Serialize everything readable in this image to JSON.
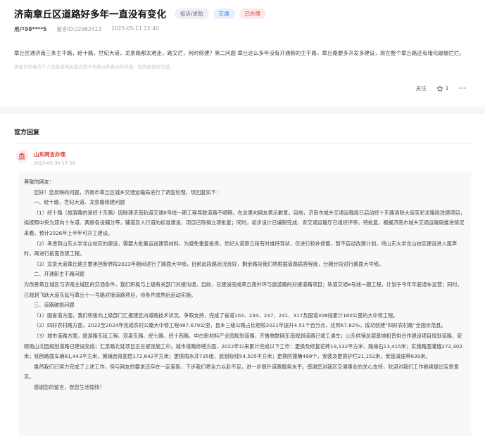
{
  "header": {
    "title": "济南章丘区道路好多年一直没有变化",
    "tags": [
      "投诉/求助",
      "交通",
      "已办理"
    ]
  },
  "meta": {
    "user": "用户98****5",
    "id_text": "留言ID:22962413",
    "time": "2025-05-11 22:40"
  },
  "description": "章丘区通济南三条主干路，经十路，世纪大道，龙泉路都太难走，路又烂，何时修建？第二问题 章丘这么多年没有开通新的主干路，章丘路要多开发多建设，现在整个章丘路还有堵化破破烂烂。",
  "notice": "该留言作者为个人信息或网友留言而不代表公开表示的内容，仅供阅读仅可见。",
  "actions": {
    "follow": "关注",
    "like_count": "1",
    "more": "···"
  },
  "official": {
    "section_title": "官方回复",
    "org_name": "山东网言办理",
    "org_time": "2025-05-30 17:58"
  },
  "reply_lines": [
    "尊敬的网友：",
    "您好！您反映的问题，济南市章丘区城乡交通运输局进行了调查处理，现回复如下：",
    "一、经十路、世纪大道、龙泉路修建问题",
    "（1）经十路（旅游路的是经十东路）因除建济南轨道交通8号线一期工程导致道路不顺畅，在这里向网友表示歉意。目前，济南市城乡交通运输局已启动经十东路清除大街至彩龙路段改建项目，拟按照中央为双向十车道、两侧各设辅分带，辅道及人行道的标准建设，项目已取得立项批复；同时，初步设计已编制完成，青交通运输厅已组织评审，待批复，根据济南市城乡交通运输局推进情况来看，预计2026年上半年可开工建设。",
    "（2）考虑到山东大学龙山校区的建设，需要大批量运送建筑材料，为避免重复投资，世纪大道章丘段有时维持现状，仅进行抢补修整，暂不启动改建计划，待山东大学龙山校区建设进入尾声时，再进行拓宽改建工程。",
    "（3）龙泉大道章丘路主要承担新界段2023年期间进行了路面大中修，目前此段路状况良好，剩余路段我们将根据道路病害程度，分期分段进行路面大中修。",
    "二、开通新主干路问题",
    "为改善章丘城区与济南主城区的交通条件，我们积极与上级有关部门对接沟通，目前，已建设完成章丘南外环与旅游路的对接道路项目；轨道交通8号线一期工程，计划于今年年底通车运营；同时，已规划飞跃大道东延与章丘十一号路对接道路项目，待条件成熟后启动实施。",
    "三、道路破损问题",
    "（1）国省道方面，我们积极向上级部门汇报建区内道路技术状况，争取支持，完成了省道102、234、237、241、317及国道308线累计160公里的大中修工程。",
    "（2）四好农村路方面，2022至2024年完成农村公路大中修工程487.679公里，县乡三级公路占比相较2021年提升4.51个百分点，达到67.82%，成功创建“四好农村路”全国示范县。",
    "（3）城市道路方面，旅游路东延工程、双泉东路、经七路、经十西路、中白新材料产业园规划道路、齐鲁物联网东南规划道路已竣工通车；山东供销总部基地和普供合作建设项目规划道路、安顺南山北园规划道路已建设完成；汇泉路北延项目正在紧张施工中。城市道路修缮方面，2022年以来累计完成以下工作：更换及修复花砖19,132平方米、路缘石13,415米；实施路面灌缝272,302米；铣刨路面车辆81,443平方米，摊铺沥青面层172,642平方米；更换雨水井735组，旅划标线54,505平方米；更换防撞桶499个，安装及更换护栏21,152米，安装减速带839米。",
    "虽然我们已努力完成了上述工作，但与网友的要求还存在一定差距，下步我们将全力以赴不足，进一步提升道路服务水平。感谢您对我区交通事业的关心支持，欢迎对我们工作继续提出宝贵意见。",
    "感谢您的留言，祝您生活愉快！"
  ],
  "colors": {
    "accent_red": "#d83c33",
    "tag_blue": "#3a7be0",
    "tag_red": "#e24a3f"
  }
}
